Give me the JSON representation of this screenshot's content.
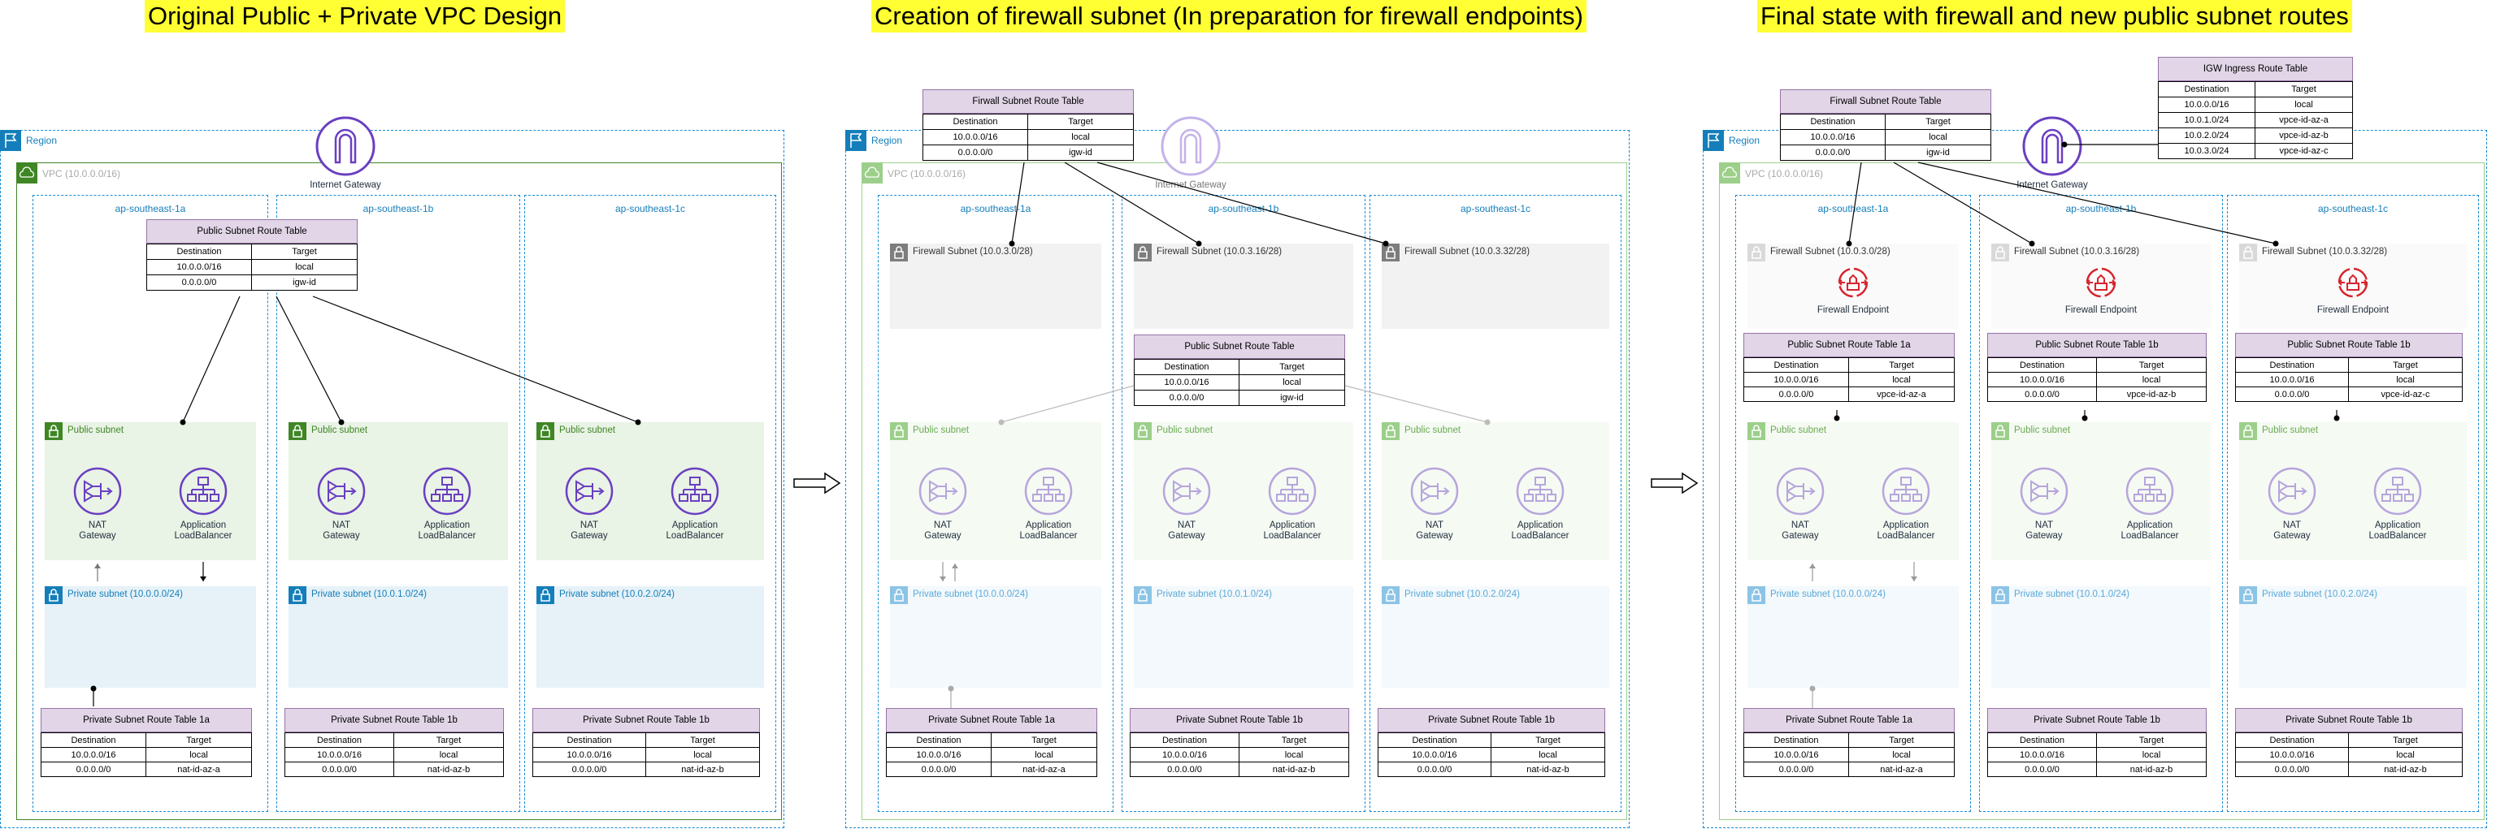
{
  "titles": [
    "Original Public + Private VPC Design",
    "Creation of firewall subnet (In preparation for firewall endpoints)",
    "Final state with firewall and new public subnet routes"
  ],
  "colors": {
    "region": "#147eba",
    "vpc": "#3f8624",
    "route_table_header": "#e1d5e7",
    "public_subnet": "#e9f3e6",
    "private_subnet": "#e6f2f8",
    "igw": "#6a3fc1",
    "firewall": "#d6242d",
    "title_highlight": "#ffff33"
  },
  "panels": [
    {
      "region": "Region",
      "vpc": "VPC (10.0.0.0/16)",
      "igw": "Internet Gateway",
      "public_rt": {
        "title": "Public Subnet Route Table",
        "header": [
          "Destination",
          "Target"
        ],
        "rows": [
          [
            "10.0.0.0/16",
            "local"
          ],
          [
            "0.0.0.0/0",
            "igw-id"
          ]
        ]
      },
      "azs": [
        {
          "name": "ap-southeast-1a",
          "public_subnet": "Public subnet",
          "nat": "NAT Gateway",
          "alb": "Application LoadBalancer",
          "private_subnet": "Private subnet (10.0.0.0/24)",
          "private_rt": {
            "title": "Private Subnet Route Table 1a",
            "header": [
              "Destination",
              "Target"
            ],
            "rows": [
              [
                "10.0.0.0/16",
                "local"
              ],
              [
                "0.0.0.0/0",
                "nat-id-az-a"
              ]
            ]
          }
        },
        {
          "name": "ap-southeast-1b",
          "public_subnet": "Public subnet",
          "nat": "NAT Gateway",
          "alb": "Application LoadBalancer",
          "private_subnet": "Private subnet (10.0.1.0/24)",
          "private_rt": {
            "title": "Private Subnet Route Table 1b",
            "header": [
              "Destination",
              "Target"
            ],
            "rows": [
              [
                "10.0.0.0/16",
                "local"
              ],
              [
                "0.0.0.0/0",
                "nat-id-az-b"
              ]
            ]
          }
        },
        {
          "name": "ap-southeast-1c",
          "public_subnet": "Public subnet",
          "nat": "NAT Gateway",
          "alb": "Application LoadBalancer",
          "private_subnet": "Private subnet (10.0.2.0/24)",
          "private_rt": {
            "title": "Private Subnet Route Table 1b",
            "header": [
              "Destination",
              "Target"
            ],
            "rows": [
              [
                "10.0.0.0/16",
                "local"
              ],
              [
                "0.0.0.0/0",
                "nat-id-az-b"
              ]
            ]
          }
        }
      ]
    },
    {
      "region": "Region",
      "vpc": "VPC (10.0.0.0/16)",
      "igw": "Internet Gateway",
      "firewall_rt": {
        "title": "Firwall Subnet Route Table",
        "header": [
          "Destination",
          "Target"
        ],
        "rows": [
          [
            "10.0.0.0/16",
            "local"
          ],
          [
            "0.0.0.0/0",
            "igw-id"
          ]
        ]
      },
      "public_rt": {
        "title": "Public Subnet Route Table",
        "header": [
          "Destination",
          "Target"
        ],
        "rows": [
          [
            "10.0.0.0/16",
            "local"
          ],
          [
            "0.0.0.0/0",
            "igw-id"
          ]
        ]
      },
      "azs": [
        {
          "name": "ap-southeast-1a",
          "firewall_subnet": "Firewall Subnet (10.0.3.0/28)",
          "public_subnet": "Public subnet",
          "nat": "NAT Gateway",
          "alb": "Application LoadBalancer",
          "private_subnet": "Private subnet (10.0.0.0/24)",
          "private_rt": {
            "title": "Private Subnet Route Table 1a",
            "header": [
              "Destination",
              "Target"
            ],
            "rows": [
              [
                "10.0.0.0/16",
                "local"
              ],
              [
                "0.0.0.0/0",
                "nat-id-az-a"
              ]
            ]
          }
        },
        {
          "name": "ap-southeast-1b",
          "firewall_subnet": "Firewall Subnet (10.0.3.16/28)",
          "public_subnet": "Public subnet",
          "nat": "NAT Gateway",
          "alb": "Application LoadBalancer",
          "private_subnet": "Private subnet (10.0.1.0/24)",
          "private_rt": {
            "title": "Private Subnet Route Table 1b",
            "header": [
              "Destination",
              "Target"
            ],
            "rows": [
              [
                "10.0.0.0/16",
                "local"
              ],
              [
                "0.0.0.0/0",
                "nat-id-az-b"
              ]
            ]
          }
        },
        {
          "name": "ap-southeast-1c",
          "firewall_subnet": "Firewall Subnet (10.0.3.32/28)",
          "public_subnet": "Public subnet",
          "nat": "NAT Gateway",
          "alb": "Application LoadBalancer",
          "private_subnet": "Private subnet (10.0.2.0/24)",
          "private_rt": {
            "title": "Private Subnet Route Table 1b",
            "header": [
              "Destination",
              "Target"
            ],
            "rows": [
              [
                "10.0.0.0/16",
                "local"
              ],
              [
                "0.0.0.0/0",
                "nat-id-az-b"
              ]
            ]
          }
        }
      ]
    },
    {
      "region": "Region",
      "vpc": "VPC (10.0.0.0/16)",
      "igw": "Internet Gateway",
      "firewall_rt": {
        "title": "Firwall Subnet Route Table",
        "header": [
          "Destination",
          "Target"
        ],
        "rows": [
          [
            "10.0.0.0/16",
            "local"
          ],
          [
            "0.0.0.0/0",
            "igw-id"
          ]
        ]
      },
      "igw_rt": {
        "title": "IGW Ingress Route Table",
        "header": [
          "Destination",
          "Target"
        ],
        "rows": [
          [
            "10.0.0.0/16",
            "local"
          ],
          [
            "10.0.1.0/24",
            "vpce-id-az-a"
          ],
          [
            "10.0.2.0/24",
            "vpce-id-az-b"
          ],
          [
            "10.0.3.0/24",
            "vpce-id-az-c"
          ]
        ]
      },
      "azs": [
        {
          "name": "ap-southeast-1a",
          "firewall_subnet": "Firewall Subnet (10.0.3.0/28)",
          "firewall_endpoint": "Firewall Endpoint",
          "public_rt": {
            "title": "Public Subnet Route Table 1a",
            "header": [
              "Destination",
              "Target"
            ],
            "rows": [
              [
                "10.0.0.0/16",
                "local"
              ],
              [
                "0.0.0.0/0",
                "vpce-id-az-a"
              ]
            ]
          },
          "public_subnet": "Public subnet",
          "nat": "NAT Gateway",
          "alb": "Application LoadBalancer",
          "private_subnet": "Private subnet (10.0.0.0/24)",
          "private_rt": {
            "title": "Private Subnet Route Table 1a",
            "header": [
              "Destination",
              "Target"
            ],
            "rows": [
              [
                "10.0.0.0/16",
                "local"
              ],
              [
                "0.0.0.0/0",
                "nat-id-az-a"
              ]
            ]
          }
        },
        {
          "name": "ap-southeast-1b",
          "firewall_subnet": "Firewall Subnet (10.0.3.16/28)",
          "firewall_endpoint": "Firewall Endpoint",
          "public_rt": {
            "title": "Public Subnet Route Table 1b",
            "header": [
              "Destination",
              "Target"
            ],
            "rows": [
              [
                "10.0.0.0/16",
                "local"
              ],
              [
                "0.0.0.0/0",
                "vpce-id-az-b"
              ]
            ]
          },
          "public_subnet": "Public subnet",
          "nat": "NAT Gateway",
          "alb": "Application LoadBalancer",
          "private_subnet": "Private subnet (10.0.1.0/24)",
          "private_rt": {
            "title": "Private Subnet Route Table 1b",
            "header": [
              "Destination",
              "Target"
            ],
            "rows": [
              [
                "10.0.0.0/16",
                "local"
              ],
              [
                "0.0.0.0/0",
                "nat-id-az-b"
              ]
            ]
          }
        },
        {
          "name": "ap-southeast-1c",
          "firewall_subnet": "Firewall Subnet (10.0.3.32/28)",
          "firewall_endpoint": "Firewall Endpoint",
          "public_rt": {
            "title": "Public Subnet Route Table 1b",
            "header": [
              "Destination",
              "Target"
            ],
            "rows": [
              [
                "10.0.0.0/16",
                "local"
              ],
              [
                "0.0.0.0/0",
                "vpce-id-az-c"
              ]
            ]
          },
          "public_subnet": "Public subnet",
          "nat": "NAT Gateway",
          "alb": "Application LoadBalancer",
          "private_subnet": "Private subnet (10.0.2.0/24)",
          "private_rt": {
            "title": "Private Subnet Route Table 1b",
            "header": [
              "Destination",
              "Target"
            ],
            "rows": [
              [
                "10.0.0.0/16",
                "local"
              ],
              [
                "0.0.0.0/0",
                "nat-id-az-b"
              ]
            ]
          }
        }
      ]
    }
  ]
}
